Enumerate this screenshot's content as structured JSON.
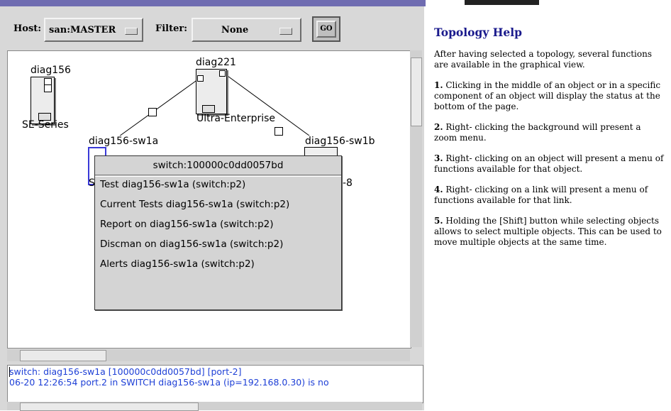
{
  "toolbar": {
    "host_label": "Host:",
    "host_value": "san:MASTER",
    "filter_label": "Filter:",
    "filter_value": "None",
    "go_label": "GO"
  },
  "topology": {
    "nodes": {
      "diag156": {
        "name": "diag156",
        "type": "SE-Series"
      },
      "diag221": {
        "name": "diag221",
        "type": "Ultra-Enterprise"
      },
      "sw1a": {
        "name": "diag156-sw1a",
        "partial_label": "S"
      },
      "sw1b": {
        "name": "diag156-sw1b",
        "partial_label": "-8"
      }
    }
  },
  "context_menu": {
    "title": "switch:100000c0dd0057bd",
    "items": [
      "Test  diag156-sw1a (switch:p2)",
      "Current Tests diag156-sw1a (switch:p2)",
      "Report on diag156-sw1a (switch:p2)",
      "Discman on diag156-sw1a (switch:p2)",
      "Alerts diag156-sw1a (switch:p2)"
    ]
  },
  "status": {
    "line1": "switch: diag156-sw1a [100000c0dd0057bd]  [port-2]",
    "line2": "06-20 12:26:54  port.2  in SWITCH diag156-sw1a (ip=192.168.0.30) is no"
  },
  "help": {
    "title": "Topology Help",
    "intro": "After having selected a topology, several functions are available in the graphical view.",
    "tips": [
      {
        "num": "1.",
        "text": "Clicking in the middle of an object or in a specific component of an object will display the status at the bottom of the page."
      },
      {
        "num": "2.",
        "text": "Right- clicking the background will present a zoom menu."
      },
      {
        "num": "3.",
        "text": "Right- clicking on an object will present a menu of functions available for that object."
      },
      {
        "num": "4.",
        "text": "Right- clicking on a link will present a menu of functions available for that link."
      },
      {
        "num": "5.",
        "text": "Holding the [Shift] button while selecting objects allows to select multiple objects. This can be used to move multiple objects at the same time."
      }
    ]
  }
}
